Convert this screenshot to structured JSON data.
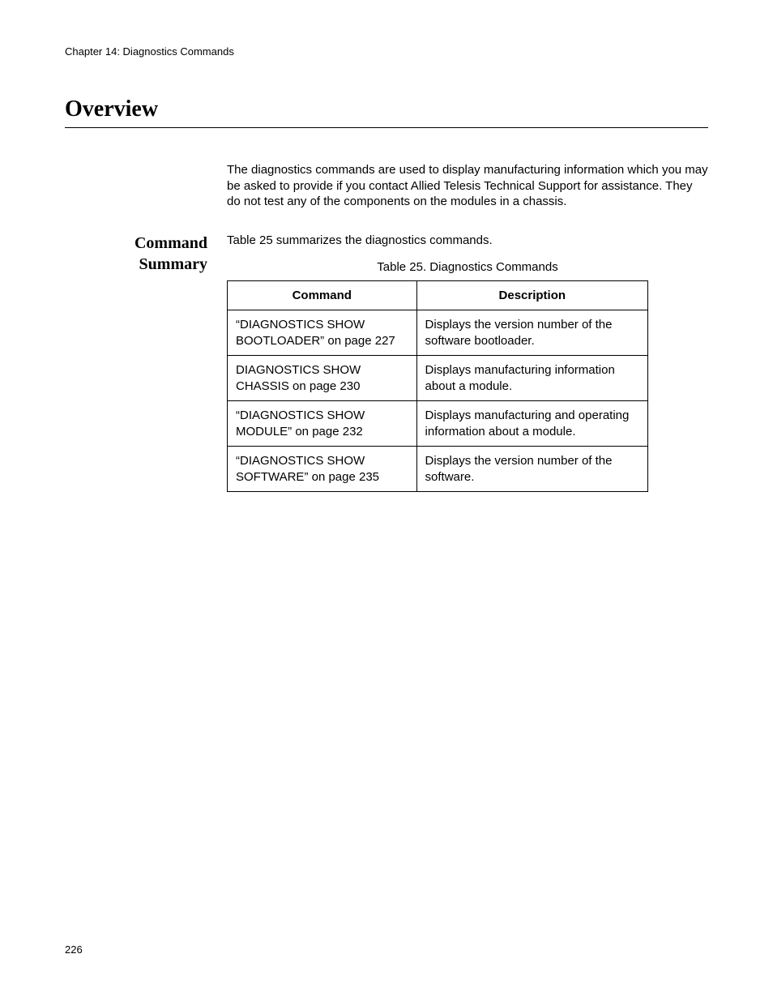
{
  "chapter_header": "Chapter 14: Diagnostics Commands",
  "title": "Overview",
  "intro": "The diagnostics commands are used to display manufacturing information which you may be asked to provide if you contact Allied Telesis Technical Support for assistance. They do not test any of the components on the modules in a chassis.",
  "side_heading": "Command Summary",
  "summary_intro": "Table 25 summarizes the diagnostics commands.",
  "table_caption": "Table 25. Diagnostics Commands",
  "table": {
    "headers": {
      "command": "Command",
      "description": "Description"
    },
    "rows": [
      {
        "command": "“DIAGNOSTICS SHOW BOOTLOADER” on page 227",
        "description": "Displays the version number of the software bootloader."
      },
      {
        "command": "DIAGNOSTICS SHOW CHASSIS on page 230",
        "description": "Displays manufacturing information about a module."
      },
      {
        "command": "“DIAGNOSTICS SHOW MODULE” on page 232",
        "description": "Displays manufacturing and operating information about a module."
      },
      {
        "command": "“DIAGNOSTICS SHOW SOFTWARE” on page 235",
        "description": "Displays the version number of the software."
      }
    ]
  },
  "page_number": "226"
}
